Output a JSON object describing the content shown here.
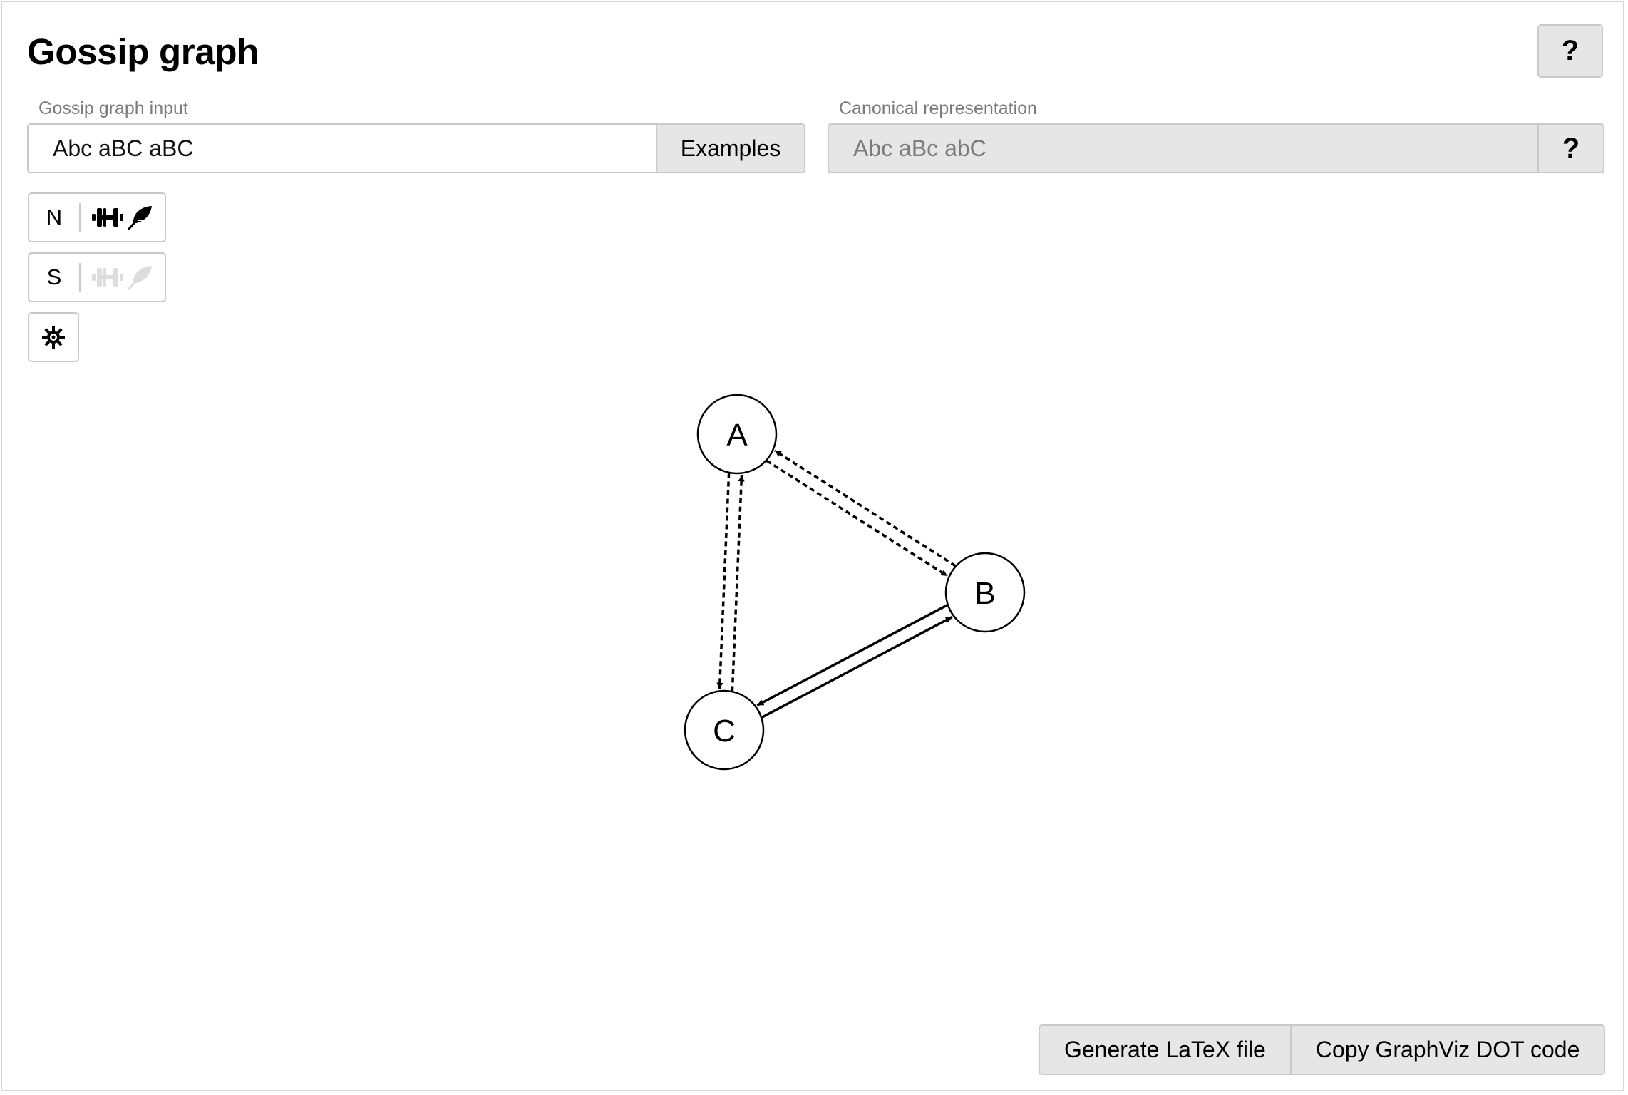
{
  "header": {
    "title": "Gossip graph",
    "help_label": "?"
  },
  "input": {
    "label": "Gossip graph input",
    "value": "Abc aBC aBC",
    "examples_label": "Examples"
  },
  "canonical": {
    "label": "Canonical representation",
    "value": "Abc aBc abC",
    "help_label": "?"
  },
  "modes": [
    {
      "letter": "N",
      "icons": [
        "dumbbell-icon",
        "feather-icon"
      ],
      "active": true
    },
    {
      "letter": "S",
      "icons": [
        "dumbbell-icon",
        "feather-icon"
      ],
      "active": false
    }
  ],
  "settings": {
    "icon": "gear-icon"
  },
  "graph": {
    "nodes": [
      {
        "id": "A",
        "label": "A"
      },
      {
        "id": "B",
        "label": "B"
      },
      {
        "id": "C",
        "label": "C"
      }
    ],
    "edges": [
      {
        "from": "A",
        "to": "B",
        "style": "dashed"
      },
      {
        "from": "B",
        "to": "A",
        "style": "dashed"
      },
      {
        "from": "A",
        "to": "C",
        "style": "dashed"
      },
      {
        "from": "C",
        "to": "A",
        "style": "dashed"
      },
      {
        "from": "B",
        "to": "C",
        "style": "solid"
      },
      {
        "from": "C",
        "to": "B",
        "style": "solid"
      }
    ]
  },
  "actions": {
    "latex_label": "Generate LaTeX file",
    "dot_label": "Copy GraphViz DOT code"
  }
}
